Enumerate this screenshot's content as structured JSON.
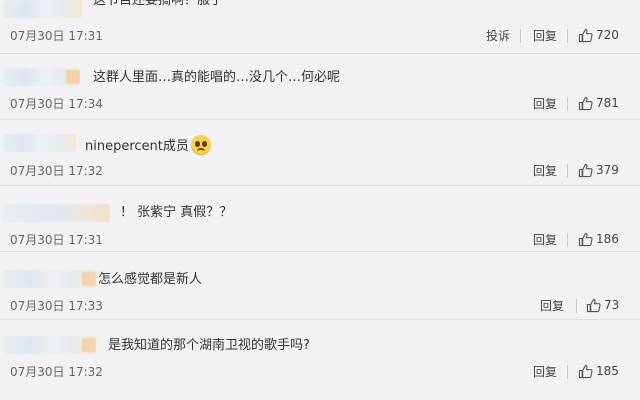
{
  "comments": [
    {
      "text": "这节目还要搞啊？服了",
      "time": "07月30日 17:31",
      "report": "投诉",
      "reply": "回复",
      "likes": "720"
    },
    {
      "text": "这群人里面…真的能唱的…没几个…何必呢",
      "time": "07月30日 17:34",
      "reply": "回复",
      "likes": "781"
    },
    {
      "text": "ninepercent成员",
      "time": "07月30日 17:32",
      "reply": "回复",
      "likes": "379",
      "emoji": "crying-face"
    },
    {
      "text": "！ 张紫宁 真假？？",
      "time": "07月30日 17:31",
      "reply": "回复",
      "likes": "186"
    },
    {
      "text": "怎么感觉都是新人",
      "time": "07月30日 17:33",
      "reply": "回复",
      "likes": "73"
    },
    {
      "text": "是我知道的那个湖南卫视的歌手吗?",
      "time": "07月30日 17:32",
      "reply": "回复",
      "likes": "185"
    }
  ],
  "icons": {
    "like": "thumbs-up-icon",
    "emoji": "crying-face-icon"
  },
  "colors": {
    "background": "#f2f2f5",
    "text": "#333333",
    "muted": "#666666",
    "separator": "#dcdce0"
  }
}
